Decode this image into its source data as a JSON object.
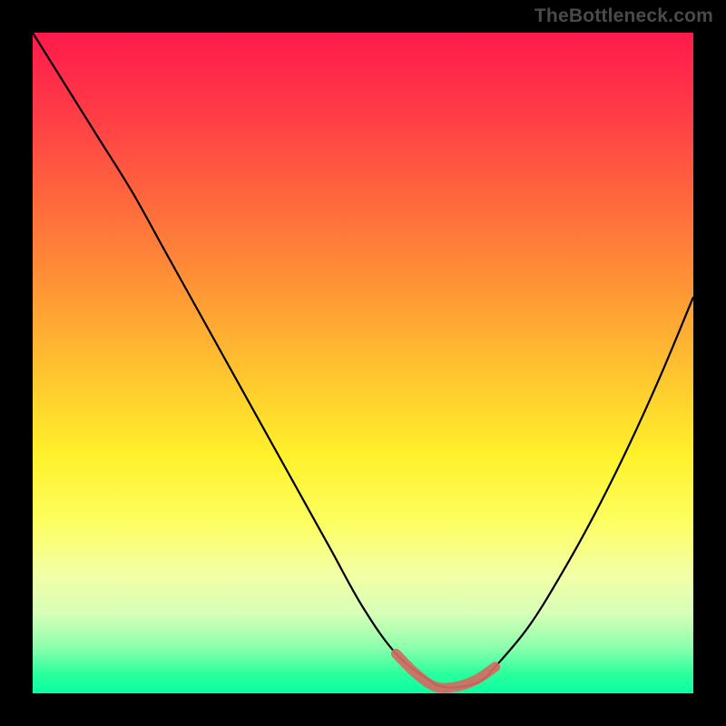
{
  "watermark": "TheBottleneck.com",
  "chart_data": {
    "type": "line",
    "title": "",
    "xlabel": "",
    "ylabel": "",
    "xlim": [
      0,
      100
    ],
    "ylim": [
      0,
      100
    ],
    "series": [
      {
        "name": "bottleneck-curve",
        "x": [
          0,
          5,
          10,
          15,
          20,
          25,
          30,
          35,
          40,
          45,
          50,
          55,
          60,
          62,
          65,
          68,
          70,
          75,
          80,
          85,
          90,
          95,
          100
        ],
        "y": [
          100,
          92,
          84,
          76,
          67,
          58,
          49,
          40,
          31,
          22,
          13,
          6,
          2,
          1,
          1,
          2,
          4,
          10,
          18,
          27,
          37,
          48,
          60
        ]
      },
      {
        "name": "optimal-range",
        "x": [
          55,
          58,
          61,
          64,
          67,
          70
        ],
        "y": [
          6,
          3,
          1,
          1,
          2,
          4
        ]
      }
    ],
    "background_gradient": {
      "top": "#ff1a4b",
      "mid": "#fff12b",
      "bottom": "#08ffa1"
    }
  }
}
